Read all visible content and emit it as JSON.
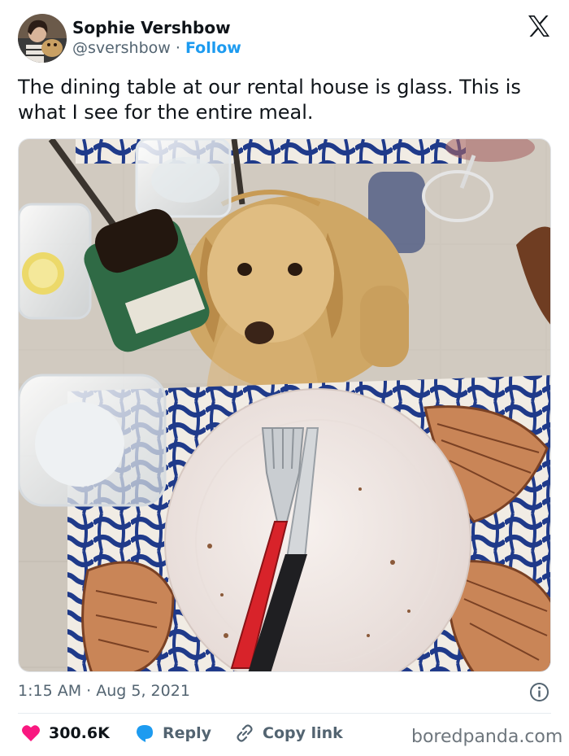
{
  "author": {
    "name": "Sophie Vershbow",
    "handle": "@svershbow",
    "separator": "·",
    "follow_label": "Follow"
  },
  "tweet": {
    "text": "The dining table at our rental house is glass. This is what I see for the entire meal."
  },
  "meta": {
    "time": "1:15 AM",
    "separator": "·",
    "date": "Aug 5, 2021"
  },
  "actions": {
    "likes_count": "300.6K",
    "reply_label": "Reply",
    "copy_link_label": "Copy link"
  },
  "watermark": "boredpanda.com",
  "icons": {
    "logo": "x-logo-icon",
    "info": "info-icon",
    "like": "heart-icon",
    "reply": "speech-bubble-icon",
    "copy": "link-icon"
  },
  "colors": {
    "accent": "#1d9bf0",
    "like": "#f91880",
    "text": "#0f1419",
    "muted": "#536471"
  }
}
